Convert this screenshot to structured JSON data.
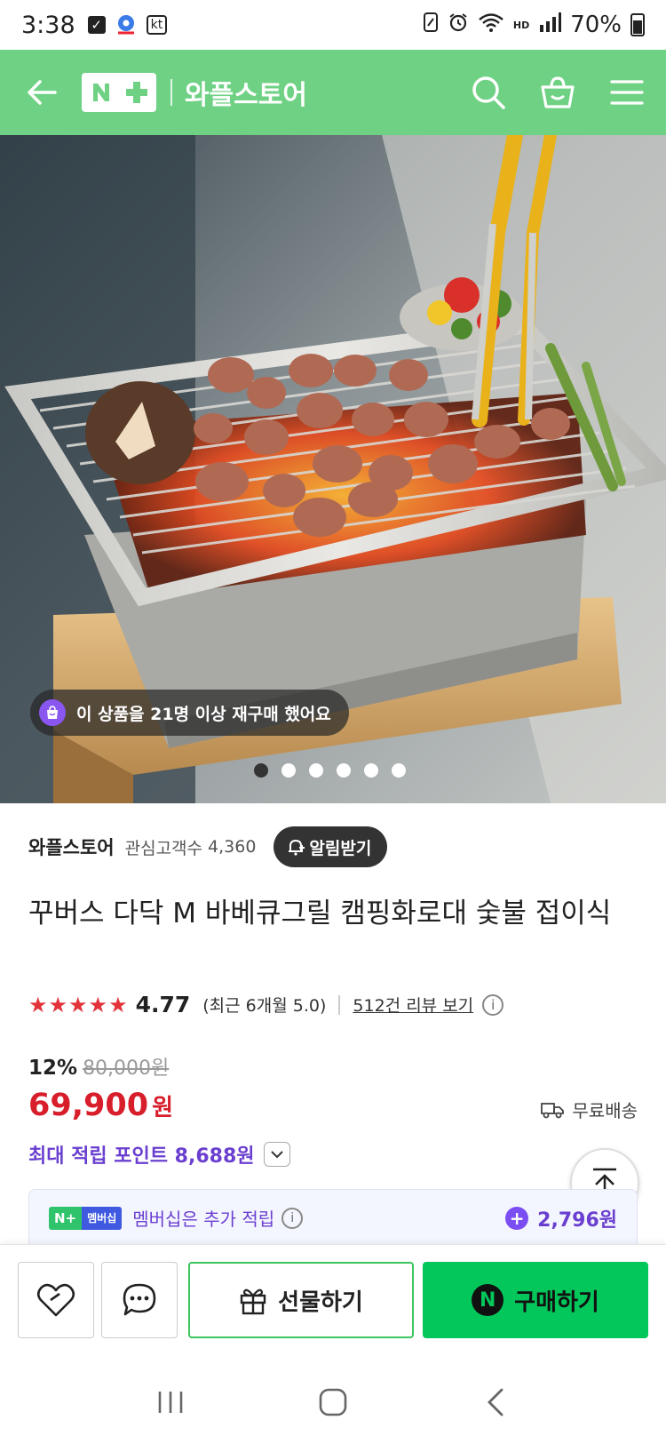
{
  "status_bar": {
    "time": "3:38",
    "carrier": "kt",
    "hd_label": "HD",
    "battery": "70%"
  },
  "header": {
    "logo_text": "N+",
    "title": "와플스토어"
  },
  "hero": {
    "repurchase_text": "이 상품을 21명 이상 재구매 했어요",
    "slide_count": 6,
    "active_slide": 1
  },
  "store": {
    "name": "와플스토어",
    "follower_label": "관심고객수",
    "follower_count": "4,360",
    "alarm_label": "알림받기"
  },
  "product": {
    "title": "꾸버스 다닥 M 바베큐그릴 캠핑화로대 숯불 접이식"
  },
  "rating": {
    "stars": "★★★★★",
    "score": "4.77",
    "recent": "(최근 6개월 5.0)",
    "review_link": "512건 리뷰 보기"
  },
  "price": {
    "discount": "12%",
    "original": "80,000원",
    "current": "69,900",
    "unit": "원",
    "shipping": "무료배송"
  },
  "points": {
    "label": "최대 적립 포인트 8,688원"
  },
  "membership": {
    "badge_np": "N+",
    "badge_label": "멤버십",
    "text": "멤버십은 추가 적립",
    "amount": "2,796원"
  },
  "actions": {
    "gift_label": "선물하기",
    "buy_label": "구매하기"
  },
  "colors": {
    "header_green": "#6fd183",
    "buy_green": "#03c75a",
    "price_red": "#d71e2a",
    "points_purple": "#6a3fd0"
  }
}
